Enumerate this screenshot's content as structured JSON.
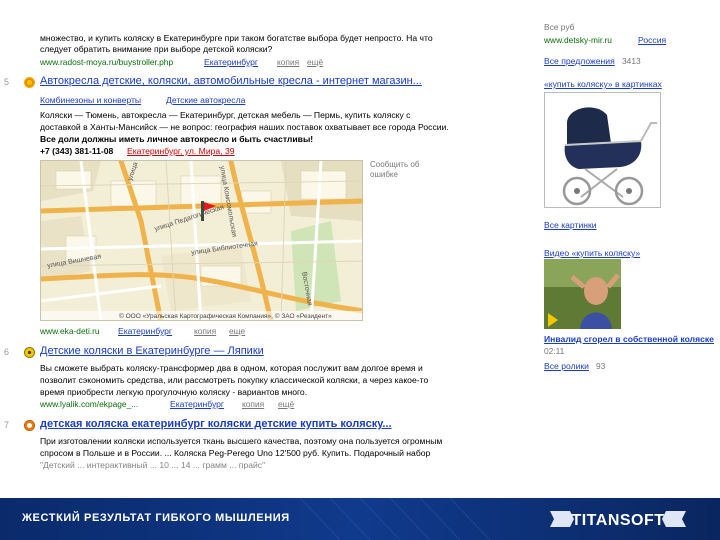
{
  "results": {
    "top": {
      "line1": "множество, и купить коляску в Екатеринбурге при таком богатстве выбора будет непросто. На что",
      "line2": "следует обратить внимание при выборе детской коляски?",
      "url": "www.radost-moya.ru/buystroller.php",
      "region": "Екатеринбург",
      "copy": "копия",
      "more": "ещё"
    },
    "r5": {
      "num": "5",
      "title": "Автокресла детские, коляски, автомобильные кресла - интернет магазин...",
      "cat1": "Комбинезоны и конверты",
      "cat2": "Детские автокресла",
      "line1": "Коляски — Тюмень, автокресла — Екатеринбург, детская мебель — Пермь, купить коляску с",
      "line2": "доставкой в Ханты-Мансийск — не вопрос: география наших поставок охватывает все города России.",
      "line3": "Все доли должны иметь личное автокресло и быть счастливы!",
      "phone": "+7 (343) 381-11-08",
      "address": "Екатеринбург, ул. Мира, 39",
      "report": "Сообщить об ошибке",
      "url": "www.eka-deti.ru",
      "region": "Екатеринбург",
      "copy": "копия",
      "more": "еще"
    },
    "map": {
      "streets": [
        "улица Гагарина",
        "улица Первомайская",
        "улица Комсомольская",
        "улица Мира",
        "улица Библиотечная",
        "улица Вишневая",
        "улица Педагогическая",
        "Восточная"
      ],
      "copyright": "© ООО «Уральская Картографическая Компания», © ЗАО «Резидент»"
    },
    "r6": {
      "num": "6",
      "title": "Детские коляски в Екатеринбурге — Ляпики",
      "line1": "Вы сможете выбрать коляску-трансформер два в одном, которая послужит вам долгое время и",
      "line2": "позволит сэкономить средства, или рассмотреть покупку классической коляски, а через какое-то",
      "line3": "время приобрести легкую прогулочную коляску - вариантов много.",
      "url": "www.lyalik.com/ekpage_...",
      "region": "Екатеринбург",
      "copy": "копия",
      "more": "ещё"
    },
    "r7": {
      "num": "7",
      "title": "детская коляска екатеринбург коляски детские купить коляску...",
      "line1": "При изготовлении коляски используется ткань высшего качества, поэтому она пользуется огромным",
      "line2": "спросом в Польше и в России. ... Коляска Peg-Perego Uno 12'500 руб. Купить. Подарочный набор",
      "line3": "\"Детский ... интерактивный ... 10 ... 14 ... грамм ... прайс\""
    }
  },
  "right": {
    "top_cut": "Все руб",
    "shop_url": "www.detsky-mir.ru",
    "shop_country": "Россия",
    "offers_label": "Все предложения",
    "offers_count": "3413",
    "images_query": "«купить коляску» в картинках",
    "all_images": "Все картинки",
    "video_query": "Видео «купить коляску»",
    "video_title": "Инвалид сгорел в собственной коляске",
    "video_duration": "02:11",
    "all_videos": "Все ролики",
    "videos_count": "93"
  },
  "banner": {
    "slogan": "ЖЕСТКИЙ РЕЗУЛЬТАТ ГИБКОГО МЫШЛЕНИЯ",
    "brand": "TITANSOFT"
  },
  "colors": {
    "link": "#1a3dc1",
    "url": "#0a6d0a",
    "banner": "#0b2e73"
  }
}
